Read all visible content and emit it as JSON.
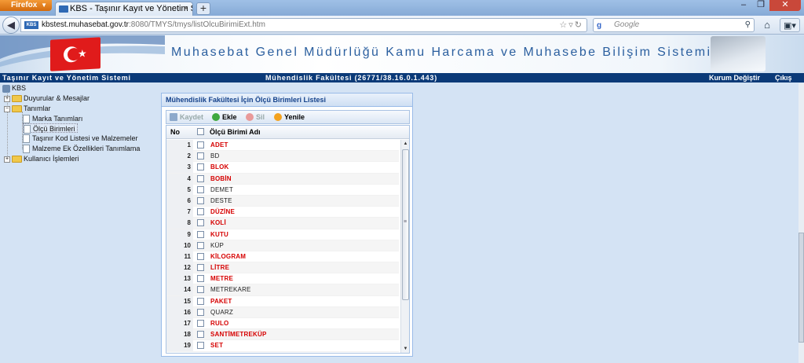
{
  "browser": {
    "menu_button": "Firefox",
    "tab_title": "KBS - Taşınır Kayıt ve Yönetim Sistemi",
    "tab_close": "×",
    "new_tab": "+",
    "url_host": "kbstest.muhasebat.gov.tr",
    "url_rest": ":8080/TMYS/tmys/listOlcuBirimiExt.htm",
    "search_placeholder": "Google",
    "search_engine_glyph": "g"
  },
  "site": {
    "banner_title": "Muhasebat Genel Müdürlüğü Kamu Harcama ve Muhasebe Bilişim Sistemi",
    "system_name": "Taşınır Kayıt ve Yönetim Sistemi",
    "unit": "Mühendislik Fakültesi (26771/38.16.0.1.443)",
    "change_org": "Kurum Değiştir",
    "logout": "Çıkış"
  },
  "tree": {
    "root": "KBS",
    "items": [
      {
        "label": "Duyurular & Mesajlar"
      },
      {
        "label": "Tanımlar"
      },
      {
        "label": "Marka Tanımları"
      },
      {
        "label": "Ölçü Birimleri"
      },
      {
        "label": "Taşınır Kod Listesi ve Malzemeler"
      },
      {
        "label": "Malzeme Ek Özellikleri Tanımlama"
      },
      {
        "label": "Kullanıcı İşlemleri"
      }
    ]
  },
  "panel": {
    "title": "Mühendislik Fakültesi İçin Ölçü Birimleri Listesi",
    "toolbar": {
      "save": "Kaydet",
      "add": "Ekle",
      "delete": "Sil",
      "refresh": "Yenile"
    },
    "columns": {
      "no": "No",
      "name": "Ölçü Birimi Adı"
    },
    "rows": [
      {
        "no": "1",
        "name": "ADET",
        "red": true
      },
      {
        "no": "2",
        "name": "BD",
        "red": false
      },
      {
        "no": "3",
        "name": "BLOK",
        "red": true
      },
      {
        "no": "4",
        "name": "BOBİN",
        "red": true
      },
      {
        "no": "5",
        "name": "DEMET",
        "red": false
      },
      {
        "no": "6",
        "name": "DESTE",
        "red": false
      },
      {
        "no": "7",
        "name": "DÜZİNE",
        "red": true
      },
      {
        "no": "8",
        "name": "KOLİ",
        "red": true
      },
      {
        "no": "9",
        "name": "KUTU",
        "red": true
      },
      {
        "no": "10",
        "name": "KÜP",
        "red": false
      },
      {
        "no": "11",
        "name": "KİLOGRAM",
        "red": true
      },
      {
        "no": "12",
        "name": "LİTRE",
        "red": true
      },
      {
        "no": "13",
        "name": "METRE",
        "red": true
      },
      {
        "no": "14",
        "name": "METREKARE",
        "red": false
      },
      {
        "no": "15",
        "name": "PAKET",
        "red": true
      },
      {
        "no": "16",
        "name": "QUARZ",
        "red": false
      },
      {
        "no": "17",
        "name": "RULO",
        "red": true
      },
      {
        "no": "18",
        "name": "SANTİMETREKÜP",
        "red": true
      },
      {
        "no": "19",
        "name": "SET",
        "red": true
      }
    ]
  },
  "colors": {
    "accent_red": "#d60000",
    "header_blue": "#0b3a78",
    "panel_title": "#15428b"
  }
}
